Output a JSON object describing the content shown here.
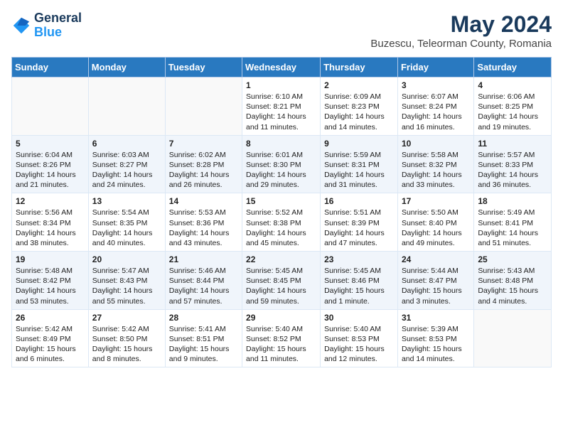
{
  "header": {
    "logo_general": "General",
    "logo_blue": "Blue",
    "title": "May 2024",
    "subtitle": "Buzescu, Teleorman County, Romania"
  },
  "columns": [
    "Sunday",
    "Monday",
    "Tuesday",
    "Wednesday",
    "Thursday",
    "Friday",
    "Saturday"
  ],
  "weeks": [
    [
      {
        "day": "",
        "info": ""
      },
      {
        "day": "",
        "info": ""
      },
      {
        "day": "",
        "info": ""
      },
      {
        "day": "1",
        "info": "Sunrise: 6:10 AM\nSunset: 8:21 PM\nDaylight: 14 hours and 11 minutes."
      },
      {
        "day": "2",
        "info": "Sunrise: 6:09 AM\nSunset: 8:23 PM\nDaylight: 14 hours and 14 minutes."
      },
      {
        "day": "3",
        "info": "Sunrise: 6:07 AM\nSunset: 8:24 PM\nDaylight: 14 hours and 16 minutes."
      },
      {
        "day": "4",
        "info": "Sunrise: 6:06 AM\nSunset: 8:25 PM\nDaylight: 14 hours and 19 minutes."
      }
    ],
    [
      {
        "day": "5",
        "info": "Sunrise: 6:04 AM\nSunset: 8:26 PM\nDaylight: 14 hours and 21 minutes."
      },
      {
        "day": "6",
        "info": "Sunrise: 6:03 AM\nSunset: 8:27 PM\nDaylight: 14 hours and 24 minutes."
      },
      {
        "day": "7",
        "info": "Sunrise: 6:02 AM\nSunset: 8:28 PM\nDaylight: 14 hours and 26 minutes."
      },
      {
        "day": "8",
        "info": "Sunrise: 6:01 AM\nSunset: 8:30 PM\nDaylight: 14 hours and 29 minutes."
      },
      {
        "day": "9",
        "info": "Sunrise: 5:59 AM\nSunset: 8:31 PM\nDaylight: 14 hours and 31 minutes."
      },
      {
        "day": "10",
        "info": "Sunrise: 5:58 AM\nSunset: 8:32 PM\nDaylight: 14 hours and 33 minutes."
      },
      {
        "day": "11",
        "info": "Sunrise: 5:57 AM\nSunset: 8:33 PM\nDaylight: 14 hours and 36 minutes."
      }
    ],
    [
      {
        "day": "12",
        "info": "Sunrise: 5:56 AM\nSunset: 8:34 PM\nDaylight: 14 hours and 38 minutes."
      },
      {
        "day": "13",
        "info": "Sunrise: 5:54 AM\nSunset: 8:35 PM\nDaylight: 14 hours and 40 minutes."
      },
      {
        "day": "14",
        "info": "Sunrise: 5:53 AM\nSunset: 8:36 PM\nDaylight: 14 hours and 43 minutes."
      },
      {
        "day": "15",
        "info": "Sunrise: 5:52 AM\nSunset: 8:38 PM\nDaylight: 14 hours and 45 minutes."
      },
      {
        "day": "16",
        "info": "Sunrise: 5:51 AM\nSunset: 8:39 PM\nDaylight: 14 hours and 47 minutes."
      },
      {
        "day": "17",
        "info": "Sunrise: 5:50 AM\nSunset: 8:40 PM\nDaylight: 14 hours and 49 minutes."
      },
      {
        "day": "18",
        "info": "Sunrise: 5:49 AM\nSunset: 8:41 PM\nDaylight: 14 hours and 51 minutes."
      }
    ],
    [
      {
        "day": "19",
        "info": "Sunrise: 5:48 AM\nSunset: 8:42 PM\nDaylight: 14 hours and 53 minutes."
      },
      {
        "day": "20",
        "info": "Sunrise: 5:47 AM\nSunset: 8:43 PM\nDaylight: 14 hours and 55 minutes."
      },
      {
        "day": "21",
        "info": "Sunrise: 5:46 AM\nSunset: 8:44 PM\nDaylight: 14 hours and 57 minutes."
      },
      {
        "day": "22",
        "info": "Sunrise: 5:45 AM\nSunset: 8:45 PM\nDaylight: 14 hours and 59 minutes."
      },
      {
        "day": "23",
        "info": "Sunrise: 5:45 AM\nSunset: 8:46 PM\nDaylight: 15 hours and 1 minute."
      },
      {
        "day": "24",
        "info": "Sunrise: 5:44 AM\nSunset: 8:47 PM\nDaylight: 15 hours and 3 minutes."
      },
      {
        "day": "25",
        "info": "Sunrise: 5:43 AM\nSunset: 8:48 PM\nDaylight: 15 hours and 4 minutes."
      }
    ],
    [
      {
        "day": "26",
        "info": "Sunrise: 5:42 AM\nSunset: 8:49 PM\nDaylight: 15 hours and 6 minutes."
      },
      {
        "day": "27",
        "info": "Sunrise: 5:42 AM\nSunset: 8:50 PM\nDaylight: 15 hours and 8 minutes."
      },
      {
        "day": "28",
        "info": "Sunrise: 5:41 AM\nSunset: 8:51 PM\nDaylight: 15 hours and 9 minutes."
      },
      {
        "day": "29",
        "info": "Sunrise: 5:40 AM\nSunset: 8:52 PM\nDaylight: 15 hours and 11 minutes."
      },
      {
        "day": "30",
        "info": "Sunrise: 5:40 AM\nSunset: 8:53 PM\nDaylight: 15 hours and 12 minutes."
      },
      {
        "day": "31",
        "info": "Sunrise: 5:39 AM\nSunset: 8:53 PM\nDaylight: 15 hours and 14 minutes."
      },
      {
        "day": "",
        "info": ""
      }
    ]
  ]
}
